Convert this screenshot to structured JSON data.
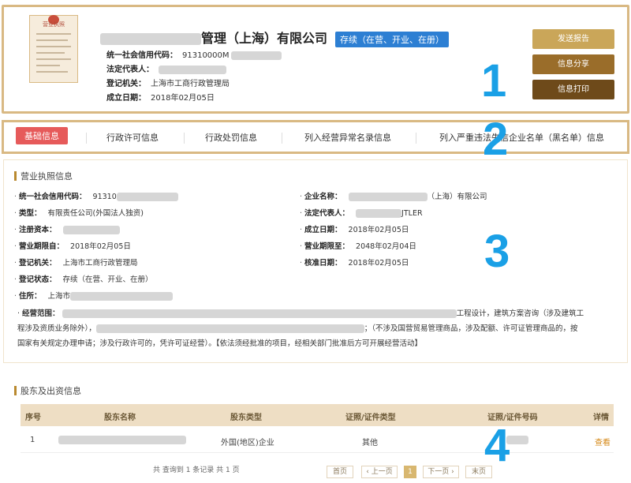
{
  "header": {
    "license_title": "营业执照",
    "company_name_suffix": "管理（上海）有限公司",
    "status_badge": "存续（在营、开业、在册）",
    "credit_code_label": "统一社会信用代码：",
    "credit_code_value": "91310000M",
    "legal_rep_label": "法定代表人：",
    "reg_authority_label": "登记机关：",
    "reg_authority_value": "上海市工商行政管理局",
    "established_label": "成立日期：",
    "established_value": "2018年02月05日",
    "buttons": {
      "send_report": "发送报告",
      "share": "信息分享",
      "print": "信息打印"
    },
    "colors": {
      "send_report": "#caa659",
      "share": "#9a6d2a",
      "print": "#6e4a1a"
    }
  },
  "annotations": {
    "n1": "1",
    "n2": "2",
    "n3": "3",
    "n4": "4",
    "color": "#1aa0e6"
  },
  "tabs": [
    {
      "label": "基础信息",
      "active": true
    },
    {
      "label": "行政许可信息"
    },
    {
      "label": "行政处罚信息"
    },
    {
      "label": "列入经营异常名录信息"
    },
    {
      "label": "列入严重违法失信企业名单（黑名单）信息"
    }
  ],
  "license_section": {
    "title": "营业执照信息",
    "fields": {
      "credit_code": {
        "label": "统一社会信用代码：",
        "value": "91310"
      },
      "company_name": {
        "label": "企业名称：",
        "value": "（上海）有限公司"
      },
      "type": {
        "label": "类型：",
        "value": "有限责任公司(外国法人独资)"
      },
      "legal_rep": {
        "label": "法定代表人：",
        "value": "JTLER"
      },
      "capital": {
        "label": "注册资本：",
        "value": ""
      },
      "established": {
        "label": "成立日期：",
        "value": "2018年02月05日"
      },
      "term_from": {
        "label": "营业期限自：",
        "value": "2018年02月05日"
      },
      "term_to": {
        "label": "营业期限至：",
        "value": "2048年02月04日"
      },
      "authority": {
        "label": "登记机关：",
        "value": "上海市工商行政管理局"
      },
      "approved": {
        "label": "核准日期：",
        "value": "2018年02月05日"
      },
      "reg_status": {
        "label": "登记状态：",
        "value": "存续（在营、开业、在册）"
      },
      "address": {
        "label": "住所：",
        "value": "上海市"
      }
    },
    "scope_label": "经营范围：",
    "scope_line1_tail": "工程设计，建筑方案咨询（涉及建筑工",
    "scope_line2_head": "程涉及资质业务除外），",
    "scope_line2_tail": "；（不涉及国营贸易管理商品，涉及配额、许可证管理商品的，按",
    "scope_line3": "国家有关规定办理申请；涉及行政许可的，凭许可证经营）。【依法须经批准的项目，经相关部门批准后方可开展经营活动】"
  },
  "shareholder_section": {
    "title": "股东及出资信息",
    "columns": [
      "序号",
      "股东名称",
      "股东类型",
      "证照/证件类型",
      "证照/证件号码",
      "详情"
    ],
    "rows": [
      {
        "index": "1",
        "name": "",
        "type": "外国(地区)企业",
        "id_type": "其他",
        "id_no": "",
        "detail": "查看"
      }
    ],
    "summary": "共 查询到 1 条记录 共 1 页",
    "pager": {
      "first": "首页",
      "prev": "‹ 上一页",
      "current": "1",
      "next": "下一页 ›",
      "last": "末页"
    }
  }
}
